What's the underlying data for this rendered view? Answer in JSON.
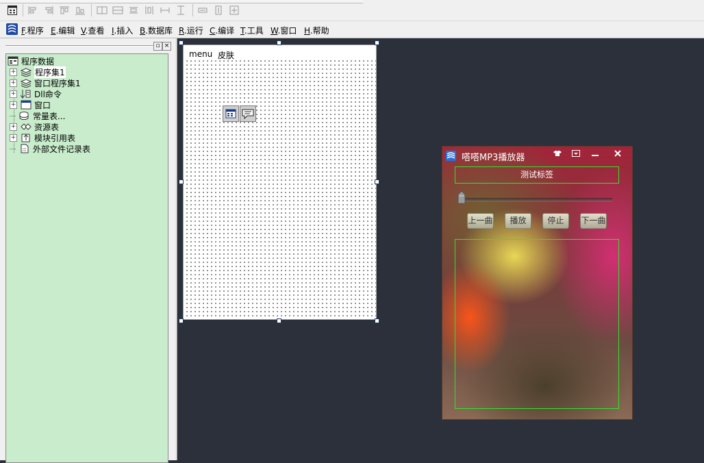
{
  "toolbar": {
    "icons": [
      "form-icon",
      "align-left-icon",
      "align-right-icon",
      "align-top-icon",
      "align-bottom-icon",
      "center-horizontal-icon",
      "center-vertical-icon",
      "distribute-horizontal-icon",
      "distribute-vertical-icon",
      "same-width-icon",
      "same-height-icon",
      "same-size-icon"
    ]
  },
  "menu": {
    "items": [
      {
        "key": "F",
        "label": ".程序"
      },
      {
        "key": "E",
        "label": ".编辑"
      },
      {
        "key": "V",
        "label": ".查看"
      },
      {
        "key": "I",
        "label": ".插入"
      },
      {
        "key": "B",
        "label": ".数据库"
      },
      {
        "key": "R",
        "label": ".运行"
      },
      {
        "key": "C",
        "label": ".编译"
      },
      {
        "key": "T",
        "label": ".工具"
      },
      {
        "key": "W",
        "label": ".窗口"
      },
      {
        "key": "H",
        "label": ".帮助"
      }
    ]
  },
  "tree": {
    "root": "程序数据",
    "items": [
      {
        "label": "程序集1",
        "expandable": true,
        "icon": "assembly-icon"
      },
      {
        "label": "窗口程序集1",
        "expandable": true,
        "icon": "assembly-icon"
      },
      {
        "label": "Dll命令",
        "expandable": true,
        "icon": "dll-command-icon"
      },
      {
        "label": "窗口",
        "expandable": true,
        "icon": "window-icon"
      },
      {
        "label": "常量表...",
        "expandable": false,
        "icon": "constant-table-icon"
      },
      {
        "label": "资源表",
        "expandable": true,
        "icon": "resource-table-icon"
      },
      {
        "label": "模块引用表",
        "expandable": true,
        "icon": "module-reference-icon"
      },
      {
        "label": "外部文件记录表",
        "expandable": false,
        "icon": "external-file-icon"
      }
    ]
  },
  "designer": {
    "menu_items": [
      "menu",
      "皮肤"
    ]
  },
  "player": {
    "title": "嗒嗒MP3播放器",
    "label_text": "测试标签",
    "progress": 0,
    "buttons": [
      "上一曲",
      "播放",
      "停止",
      "下一曲"
    ]
  },
  "colors": {
    "desktop_bg": "#2b303a",
    "tree_bg": "#c8eccc",
    "frame_border": "#2ee52e"
  }
}
